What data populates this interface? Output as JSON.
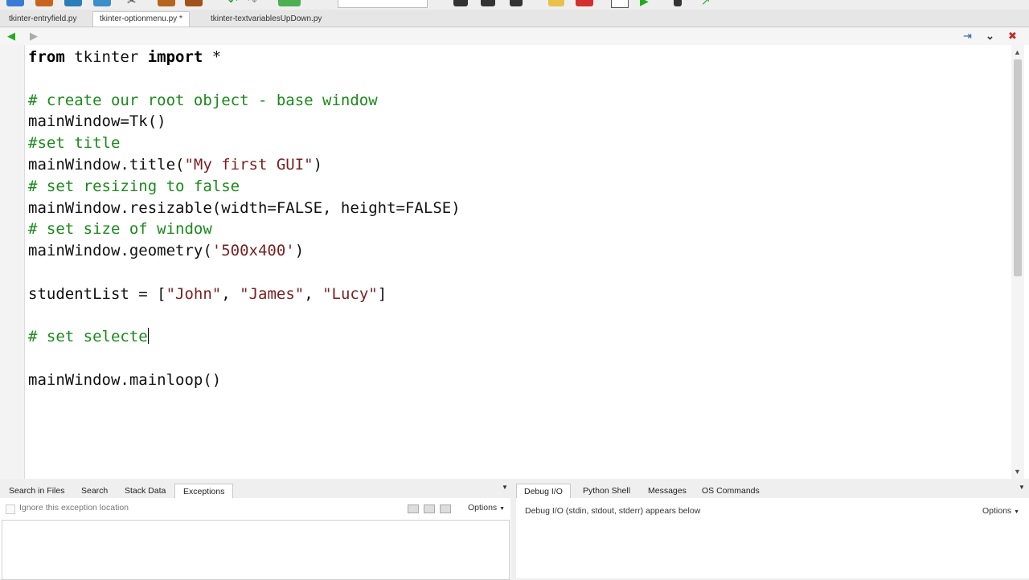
{
  "editor_tabs": [
    {
      "label": "tkinter-entryfield.py"
    },
    {
      "label": "tkinter-optionmenu.py *"
    },
    {
      "label": "tkinter-textvariablesUpDown.py"
    }
  ],
  "code": {
    "line1": {
      "kw1": "from",
      "mid": " tkinter ",
      "kw2": "import",
      "end": " *"
    },
    "line3": "# create our root object - base window",
    "line4": "mainWindow=Tk()",
    "line5": "#set title",
    "line6": {
      "pre": "mainWindow.title(",
      "str": "\"My first GUI\"",
      "post": ")"
    },
    "line7": "# set resizing to false",
    "line8": "mainWindow.resizable(width=FALSE, height=FALSE)",
    "line9": "# set size of window",
    "line10": {
      "pre": "mainWindow.geometry(",
      "str": "'500x400'",
      "post": ")"
    },
    "line12": {
      "pre": "studentList = [",
      "s1": "\"John\"",
      "c1": ", ",
      "s2": "\"James\"",
      "c2": ", ",
      "s3": "\"Lucy\"",
      "post": "]"
    },
    "line14": "# set selecte",
    "line16": "mainWindow.mainloop()"
  },
  "left_panel": {
    "tabs": [
      {
        "label": "Search in Files"
      },
      {
        "label": "Search"
      },
      {
        "label": "Stack Data"
      },
      {
        "label": "Exceptions"
      }
    ],
    "checkbox_label": "Ignore this exception location",
    "options_label": "Options"
  },
  "right_panel": {
    "tabs": [
      {
        "label": "Debug I/O"
      },
      {
        "label": "Python Shell"
      },
      {
        "label": "Messages"
      },
      {
        "label": "OS Commands"
      }
    ],
    "info": "Debug I/O (stdin, stdout, stderr) appears below",
    "options_label": "Options"
  },
  "icons": {
    "back": "◀",
    "forward": "▶",
    "pin": "⇥",
    "menu": "⌄",
    "close": "✖",
    "scroll_up": "▲",
    "scroll_down": "▼",
    "dropdown": "▼"
  },
  "colors": {
    "comment": "#1a8a1a",
    "string": "#7a1f1f",
    "back_arrow": "#22aa22"
  }
}
